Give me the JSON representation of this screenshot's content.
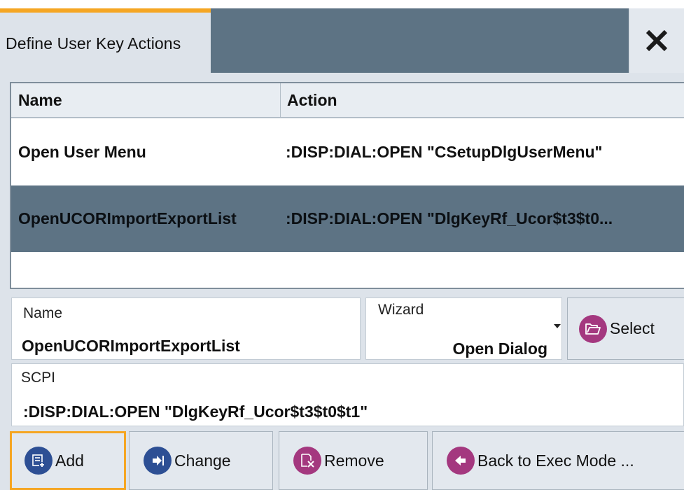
{
  "dialog": {
    "title": "Define User Key Actions",
    "close_icon": "close-icon",
    "colors": {
      "accent": "#f5a623",
      "header": "#5d7384",
      "selected_row": "#5d7384",
      "panel": "#dde3ea",
      "icon_purple": "#a4387f",
      "icon_blue": "#2d4f94"
    }
  },
  "table": {
    "columns": [
      "Name",
      "Action"
    ],
    "rows": [
      {
        "name": "Open User Menu",
        "action": ":DISP:DIAL:OPEN \"CSetupDlgUserMenu\"",
        "selected": false
      },
      {
        "name": "OpenUCORImportExportList",
        "action": ":DISP:DIAL:OPEN \"DlgKeyRf_Ucor$t3$t0...",
        "selected": true
      }
    ]
  },
  "form": {
    "name": {
      "label": "Name",
      "value": "OpenUCORImportExportList"
    },
    "wizard": {
      "label": "Wizard",
      "value": "Open Dialog"
    },
    "select": {
      "label": "Select",
      "icon": "folder-open-icon"
    },
    "scpi": {
      "label": "SCPI",
      "value": ":DISP:DIAL:OPEN \"DlgKeyRf_Ucor$t3$t0$t1\""
    }
  },
  "buttons": {
    "add": {
      "label": "Add",
      "icon": "add-entry-icon"
    },
    "change": {
      "label": "Change",
      "icon": "change-arrow-icon"
    },
    "remove": {
      "label": "Remove",
      "icon": "remove-entry-icon"
    },
    "back": {
      "label": "Back to Exec Mode ...",
      "icon": "back-arrow-icon"
    }
  }
}
